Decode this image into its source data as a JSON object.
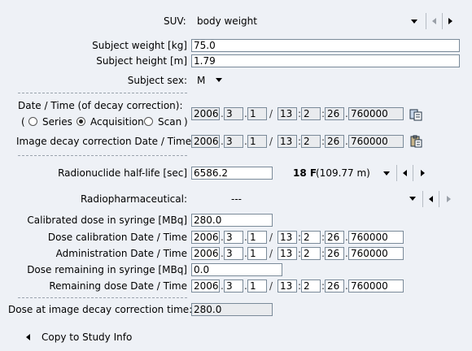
{
  "suv": {
    "label": "SUV:",
    "value": "body weight"
  },
  "subject": {
    "weight_label": "Subject weight [kg]",
    "weight": "75.0",
    "height_label": "Subject height [m]",
    "height": "1.79",
    "sex_label": "Subject sex:",
    "sex": "M"
  },
  "decay": {
    "title": "Date / Time (of decay correction):",
    "paren_open": "(",
    "paren_close": ")",
    "options": [
      "Series",
      "Acquisition",
      "Scan"
    ],
    "selected": "Acquisition",
    "date": [
      "2006",
      "3",
      "1",
      "13",
      "2",
      "26",
      "760000"
    ],
    "image_label": "Image decay correction Date / Time",
    "image_date": [
      "2006",
      "3",
      "1",
      "13",
      "2",
      "26",
      "760000"
    ]
  },
  "radionuclide": {
    "halflife_label": "Radionuclide half-life [sec]",
    "halflife": "6586.2",
    "isotope": "18 F",
    "isotope_detail": "(109.77 m)",
    "pharma_label": "Radiopharmaceutical:",
    "pharma_value": "---"
  },
  "dose": {
    "calibrated_label": "Calibrated dose in syringe [MBq]",
    "calibrated": "280.0",
    "calib_time_label": "Dose calibration Date / Time",
    "calib_time": [
      "2006",
      "3",
      "1",
      "13",
      "2",
      "26",
      "760000"
    ],
    "admin_time_label": "Administration Date / Time",
    "admin_time": [
      "2006",
      "3",
      "1",
      "13",
      "2",
      "26",
      "760000"
    ],
    "remaining_label": "Dose remaining in syringe [MBq]",
    "remaining": "0.0",
    "remaining_time_label": "Remaining dose Date / Time",
    "remaining_time": [
      "2006",
      "3",
      "1",
      "13",
      "2",
      "26",
      "760000"
    ],
    "at_decay_label": "Dose at image decay correction time:",
    "at_decay": "280.0"
  },
  "copy_label": "Copy to Study Info",
  "separators": {
    "dot": ".",
    "slash": "/",
    "colon": ":"
  }
}
